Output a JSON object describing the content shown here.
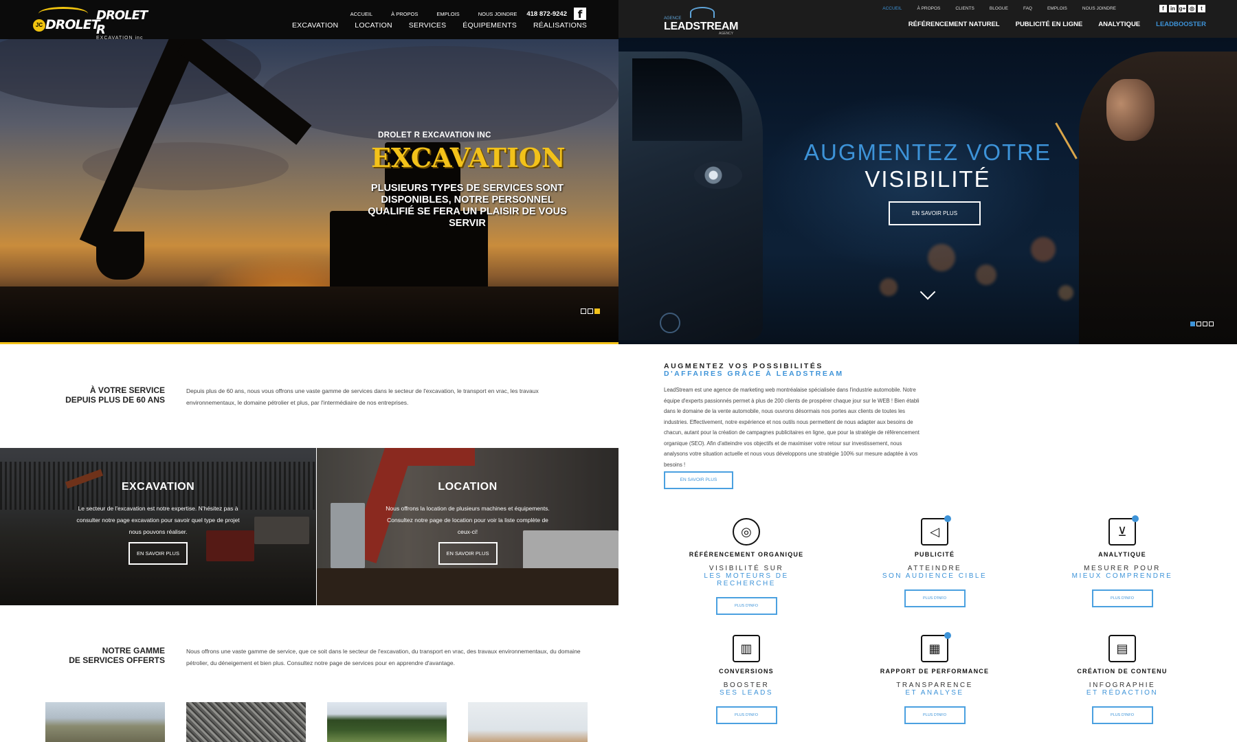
{
  "drolet": {
    "logo_primary": "DROLET",
    "logo_primary_badge": "JC",
    "logo_secondary": "DROLET R",
    "logo_secondary_sub": "EXCAVATION inc",
    "top_nav": [
      "ACCUEIL",
      "À PROPOS",
      "EMPLOIS",
      "NOUS JOINDRE"
    ],
    "phone": "418 872-9242",
    "facebook_glyph": "f",
    "main_nav": [
      "EXCAVATION",
      "LOCATION",
      "SERVICES",
      "ÉQUIPEMENTS",
      "RÉALISATIONS"
    ],
    "hero": {
      "kicker": "DROLET R EXCAVATION INC",
      "headline": "EXCAVATION",
      "body": "PLUSIEURS TYPES DE SERVICES SONT DISPONIBLES, NOTRE PERSONNEL QUALIFIÉ SE FERA UN PLAISIR DE VOUS SERVIR",
      "slide_count": 3,
      "active_slide": 3
    },
    "intro": {
      "heading_line1": "À VOTRE SERVICE",
      "heading_line2": "DEPUIS PLUS DE 60 ANS",
      "text": "Depuis plus de 60 ans, nous vous offrons une vaste gamme de services dans le secteur de l'excavation, le transport en vrac, les travaux environnementaux, le domaine pétrolier et plus, par l'intermédiaire de nos entreprises."
    },
    "tiles": [
      {
        "title": "EXCAVATION",
        "text": "Le secteur de l'excavation est notre expertise. N'hésitez pas à consulter notre page excavation pour savoir quel type de projet nous pouvons réaliser.",
        "button": "EN SAVOIR PLUS"
      },
      {
        "title": "LOCATION",
        "text": "Nous offrons la location de plusieurs machines et équipements. Consultez notre page de location pour voir la liste complète de ceux-ci!",
        "button": "EN SAVOIR PLUS"
      }
    ],
    "gamme": {
      "heading_line1": "NOTRE GAMME",
      "heading_line2": "DE SERVICES OFFERTS",
      "text": "Nous offrons une vaste gamme de service, que ce soit dans le secteur de l'excavation, du transport en vrac, des travaux environnementaux, du domaine pétrolier, du déneigement et bien plus. Consultez notre page de services pour en apprendre d'avantage."
    },
    "colors": {
      "accent": "#f3c21a",
      "header": "#0b0b0b"
    }
  },
  "lead": {
    "logo_small": "AGENCE",
    "logo_word": "LEADSTREAM",
    "logo_sub": "AGENCY",
    "top_nav": [
      "ACCUEIL",
      "À PROPOS",
      "CLIENTS",
      "BLOGUE",
      "FAQ",
      "EMPLOIS",
      "NOUS JOINDRE"
    ],
    "top_nav_active": "ACCUEIL",
    "social_icons": [
      "f",
      "in",
      "g+",
      "◎",
      "t"
    ],
    "main_nav": [
      "RÉFÉRENCEMENT NATUREL",
      "PUBLICITÉ EN LIGNE",
      "ANALYTIQUE",
      "LEADBOOSTER"
    ],
    "main_nav_highlight": "LEADBOOSTER",
    "hero": {
      "line1": "AUGMENTEZ VOTRE",
      "line2": "VISIBILITÉ",
      "button": "EN SAVOIR PLUS",
      "slide_count": 4,
      "active_slide": 1
    },
    "about": {
      "kicker_line1": "AUGMENTEZ VOS POSSIBILITÉS",
      "kicker_line2": "D'AFFAIRES GRÂCE À LEADSTREAM",
      "text": "LeadStream est une agence de marketing web montréalaise spécialisée dans l'industrie automobile. Notre équipe d'experts passionnés permet à plus de 200 clients de prospérer chaque jour sur le WEB ! Bien établi dans le domaine de la vente automobile, nous ouvrons désormais nos portes aux clients de toutes les industries. Effectivement, notre expérience et nos outils nous permettent de nous adapter aux besoins de chacun, autant pour la création de campagnes publicitaires en ligne, que pour la stratégie de référencement organique (SEO). Afin d'atteindre vos objectifs et de maximiser votre retour sur investissement, nous analysons votre situation actuelle et nous vous développons une stratégie 100% sur mesure adaptée à vos besoins !",
      "button": "EN SAVOIR PLUS"
    },
    "services": [
      {
        "icon": "target-icon",
        "glyph": "◎",
        "title": "RÉFÉRENCEMENT ORGANIQUE",
        "line1": "VISIBILITÉ SUR",
        "line2": "LES MOTEURS DE RECHERCHE",
        "button": "PLUS D'INFO"
      },
      {
        "icon": "megaphone-icon",
        "glyph": "◁",
        "title": "PUBLICITÉ",
        "line1": "ATTEINDRE",
        "line2": "SON AUDIENCE CIBLE",
        "button": "PLUS D'INFO"
      },
      {
        "icon": "cart-icon",
        "glyph": "⊻",
        "title": "ANALYTIQUE",
        "line1": "MESURER POUR",
        "line2": "MIEUX COMPRENDRE",
        "button": "PLUS D'INFO"
      },
      {
        "icon": "presentation-chart-icon",
        "glyph": "▥",
        "title": "CONVERSIONS",
        "line1": "BOOSTER",
        "line2": "SES LEADS",
        "button": "PLUS D'INFO"
      },
      {
        "icon": "bar-chart-icon",
        "glyph": "▦",
        "title": "RAPPORT DE PERFORMANCE",
        "line1": "TRANSPARENCE",
        "line2": "ET ANALYSE",
        "button": "PLUS D'INFO"
      },
      {
        "icon": "document-icon",
        "glyph": "▤",
        "title": "CRÉATION DE CONTENU",
        "line1": "INFOGRAPHIE",
        "line2": "ET RÉDACTION",
        "button": "PLUS D'INFO"
      }
    ],
    "colors": {
      "accent": "#3d93d8",
      "header": "#1c1c1c"
    }
  }
}
